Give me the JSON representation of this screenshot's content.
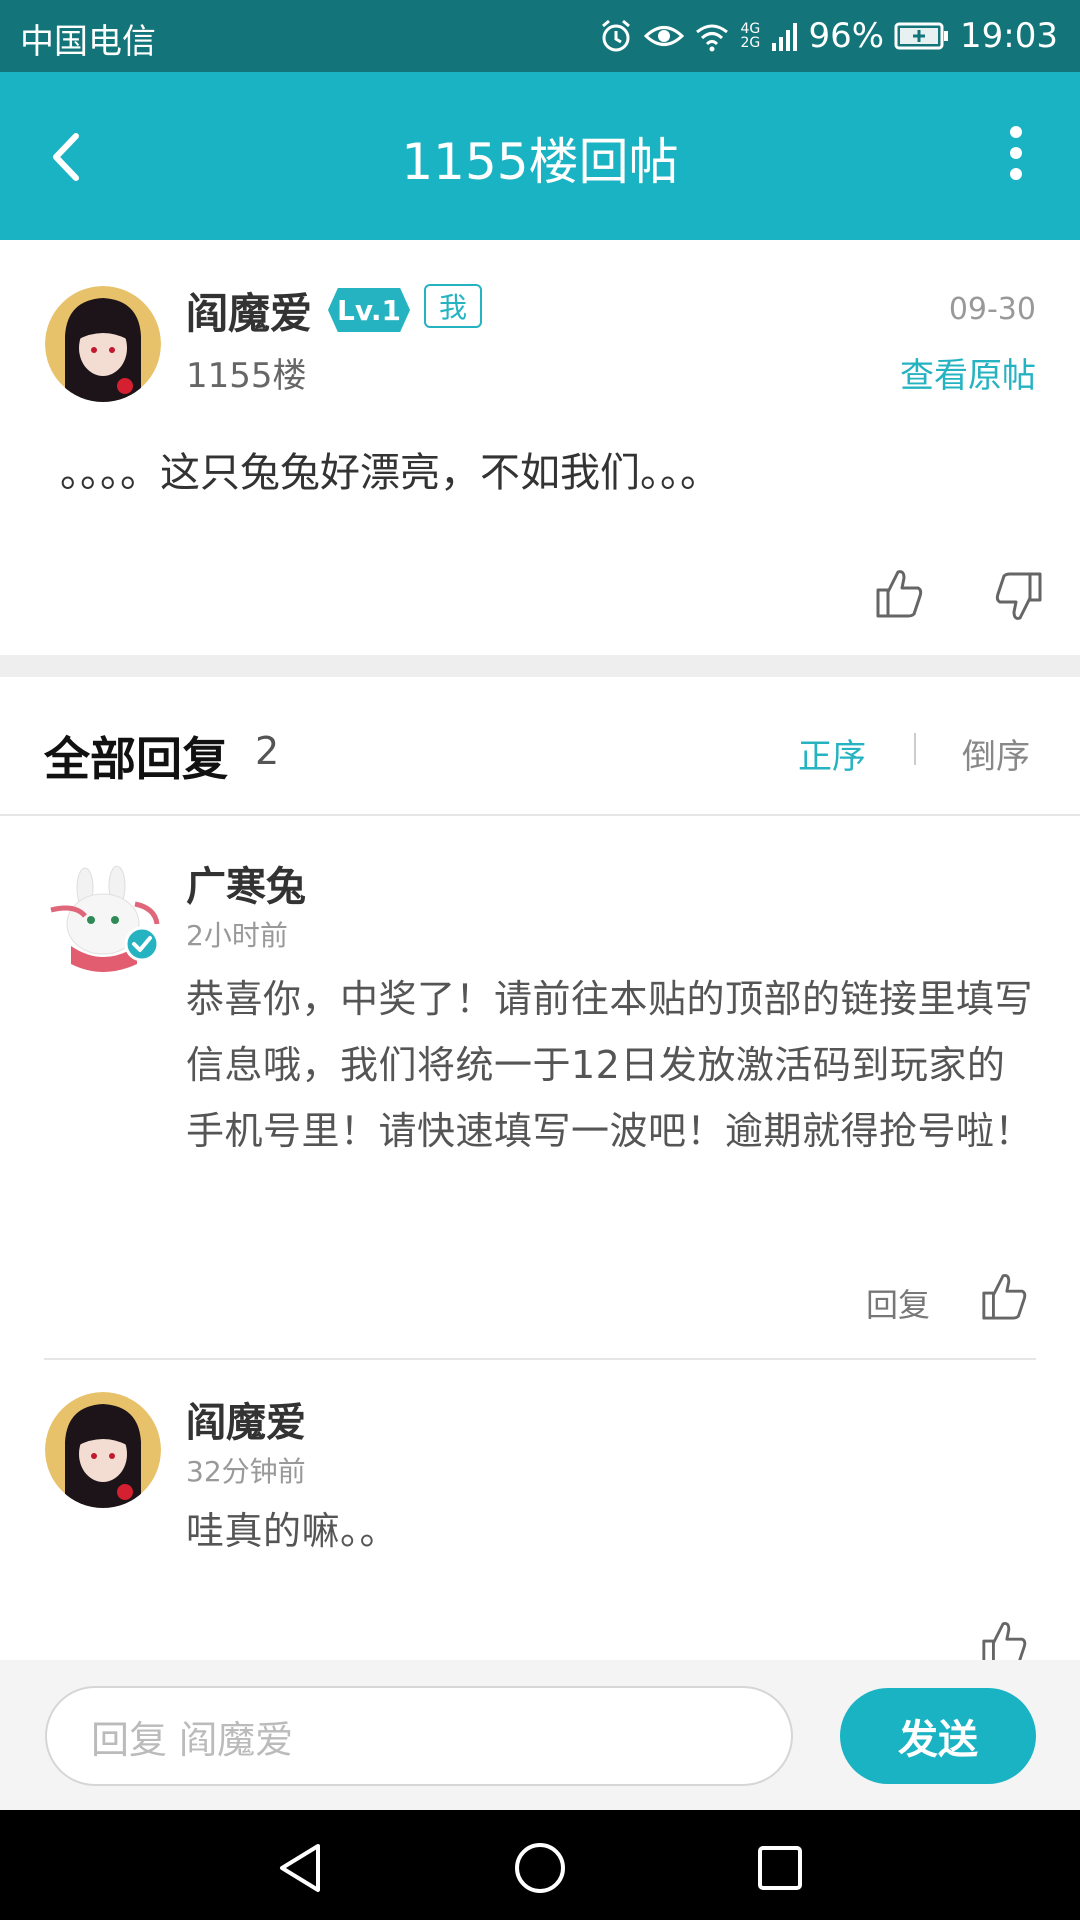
{
  "status_bar": {
    "carrier": "中国电信",
    "network": "4G 2G",
    "battery": "96%",
    "time": "19:03"
  },
  "app_bar": {
    "title": "1155楼回帖",
    "back_icon": "back-arrow-icon",
    "more_icon": "more-vert-icon"
  },
  "post": {
    "username": "阎魔爱",
    "level_badge": "Lv.1",
    "me_badge": "我",
    "date": "09-30",
    "floor": "1155楼",
    "view_original": "查看原帖",
    "content": "。。。。这只兔兔好漂亮，不如我们。。。"
  },
  "replies": {
    "title": "全部回复",
    "count": "2",
    "sort_asc": "正序",
    "sort_desc": "倒序",
    "items": [
      {
        "username": "广寒兔",
        "time": "2小时前",
        "text": "恭喜你，中奖了！请前往本贴的顶部的链接里填写信息哦，我们将统一于12日发放激活码到玩家的手机号里！请快速填写一波吧！逾期就得抢号啦！",
        "reply_label": "回复",
        "verified": true
      },
      {
        "username": "阎魔爱",
        "time": "32分钟前",
        "text": "哇真的嘛。。"
      }
    ]
  },
  "input_bar": {
    "placeholder": "回复 阎魔爱",
    "send_label": "发送"
  },
  "colors": {
    "accent": "#1ab3c3",
    "status_bar": "#137579"
  }
}
